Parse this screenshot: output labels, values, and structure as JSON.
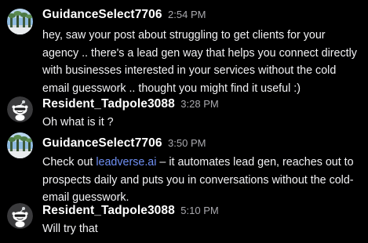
{
  "messages": [
    {
      "username": "GuidanceSelect7706",
      "time": "2:54 PM",
      "avatar": "landscape-avatar",
      "text": "hey, saw your post about struggling to get clients for your agency .. there's a lead gen way that helps you connect directly with businesses interested in your services without the cold email guesswork .. thought you might find it useful :)"
    },
    {
      "username": "Resident_Tadpole3088",
      "time": "3:28 PM",
      "avatar": "reddit-snoo-avatar",
      "text": "Oh what is it ?"
    },
    {
      "username": "GuidanceSelect7706",
      "time": "3:50 PM",
      "avatar": "landscape-avatar",
      "text_before_link": "Check out ",
      "link_text": "leadverse.ai",
      "text_after_link": " – it automates lead gen, reaches out to prospects daily and puts you in conversations without the cold-email guesswork."
    },
    {
      "username": "Resident_Tadpole3088",
      "time": "5:10 PM",
      "avatar": "reddit-snoo-avatar",
      "text": "Will try that"
    }
  ],
  "colors": {
    "background": "#000000",
    "username": "#ffffff",
    "timestamp": "#a9a9ae",
    "message_text": "#f2f2f4",
    "link": "#6f8ff2"
  }
}
